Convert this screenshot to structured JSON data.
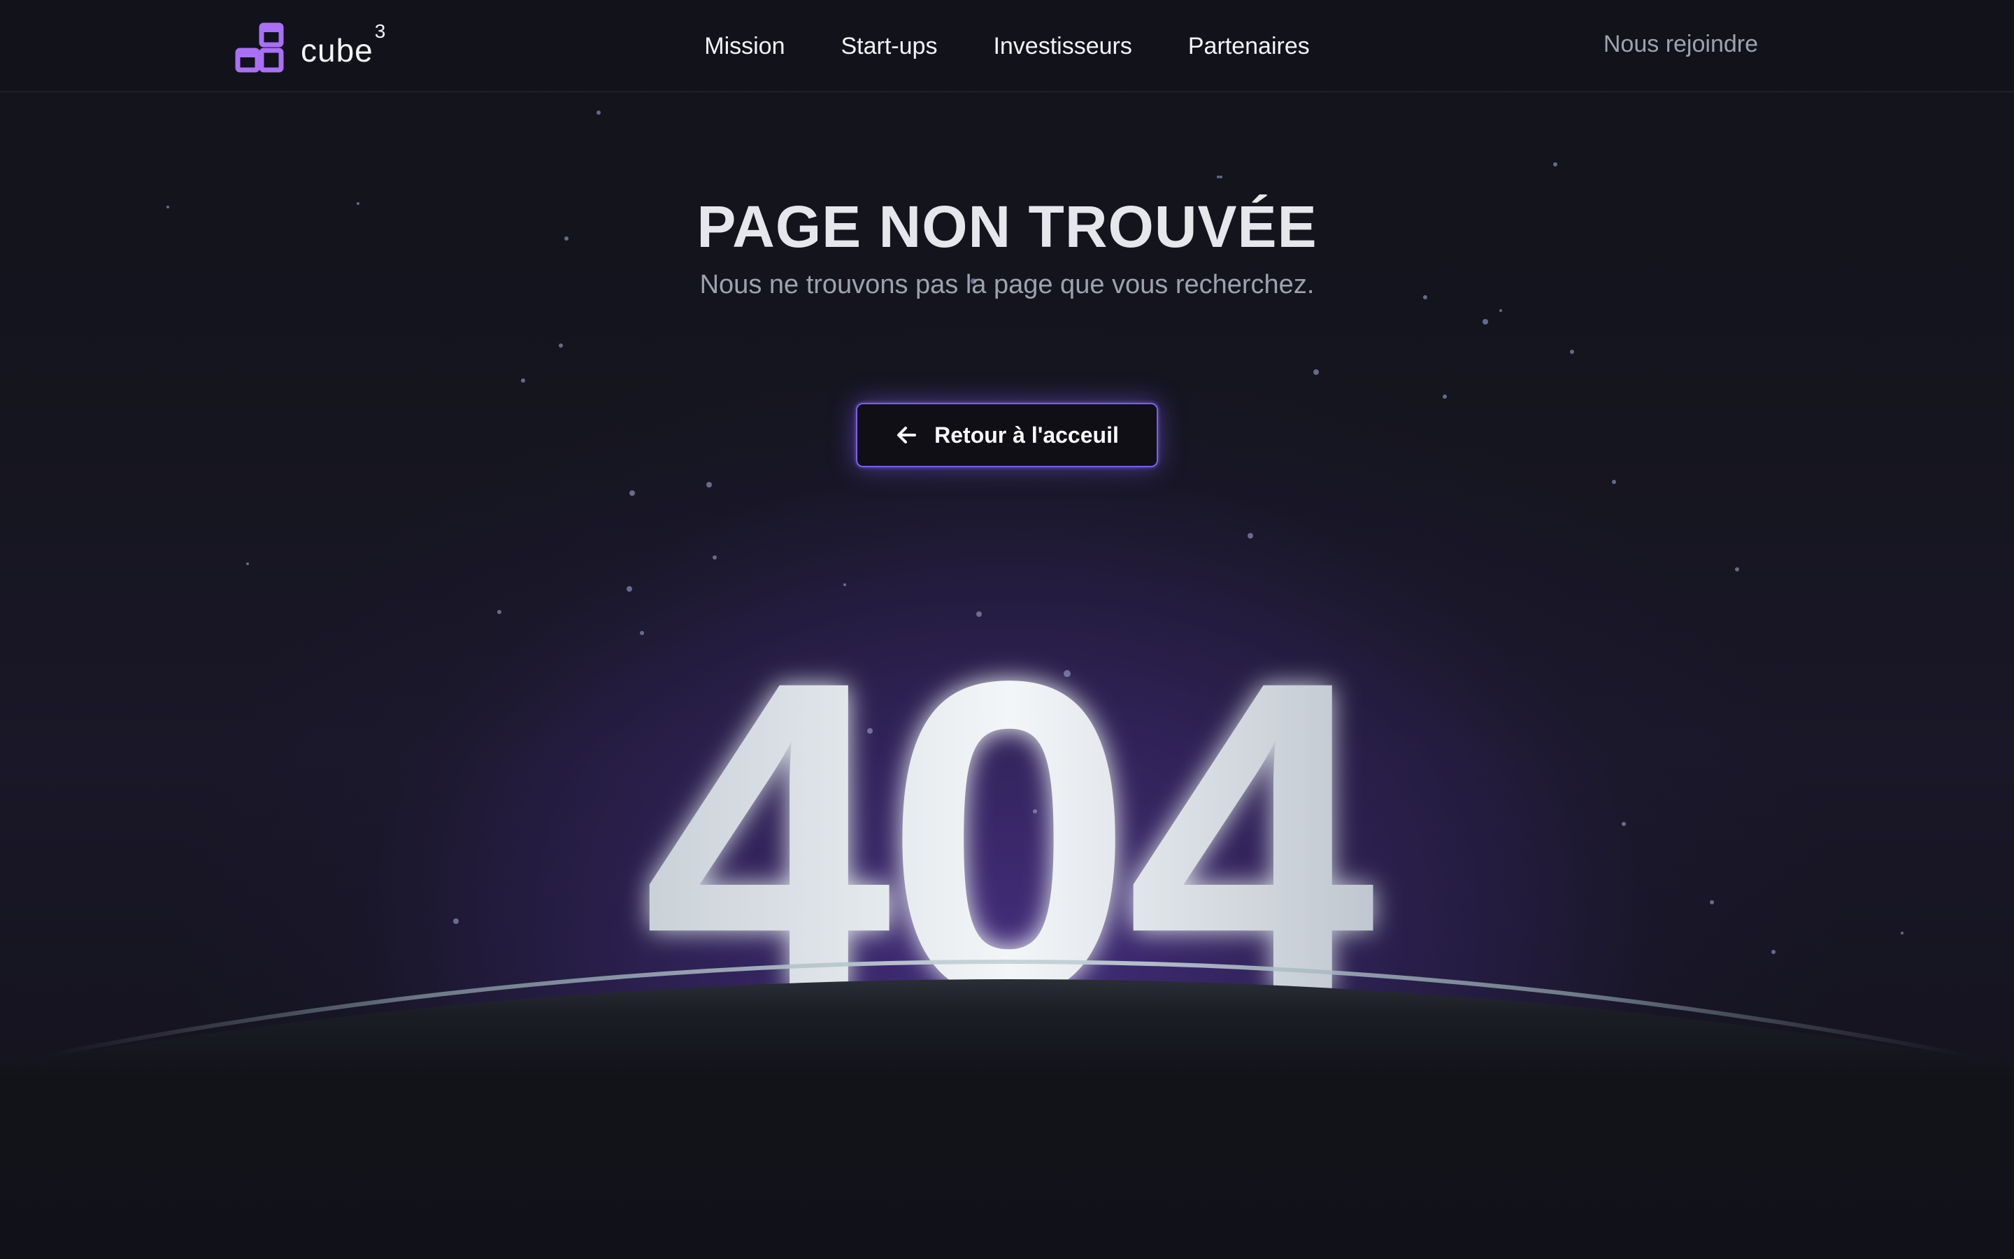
{
  "header": {
    "logo_text": "cube",
    "logo_sup": "3",
    "nav": [
      "Mission",
      "Start-ups",
      "Investisseurs",
      "Partenaires"
    ],
    "join_label": "Nous rejoindre"
  },
  "main": {
    "title": "PAGE NON TROUVÉE",
    "subtitle": "Nous ne trouvons pas la page que vous recherchez.",
    "back_button_label": "Retour à l'acceuil",
    "error_code": "404"
  },
  "colors": {
    "accent": "#7c5cf0",
    "logo": "#a970f5",
    "background": "#111219",
    "glyph": "#e8edf0"
  },
  "icons": {
    "logo": "cube-logo-icon",
    "back": "arrow-left-icon"
  }
}
